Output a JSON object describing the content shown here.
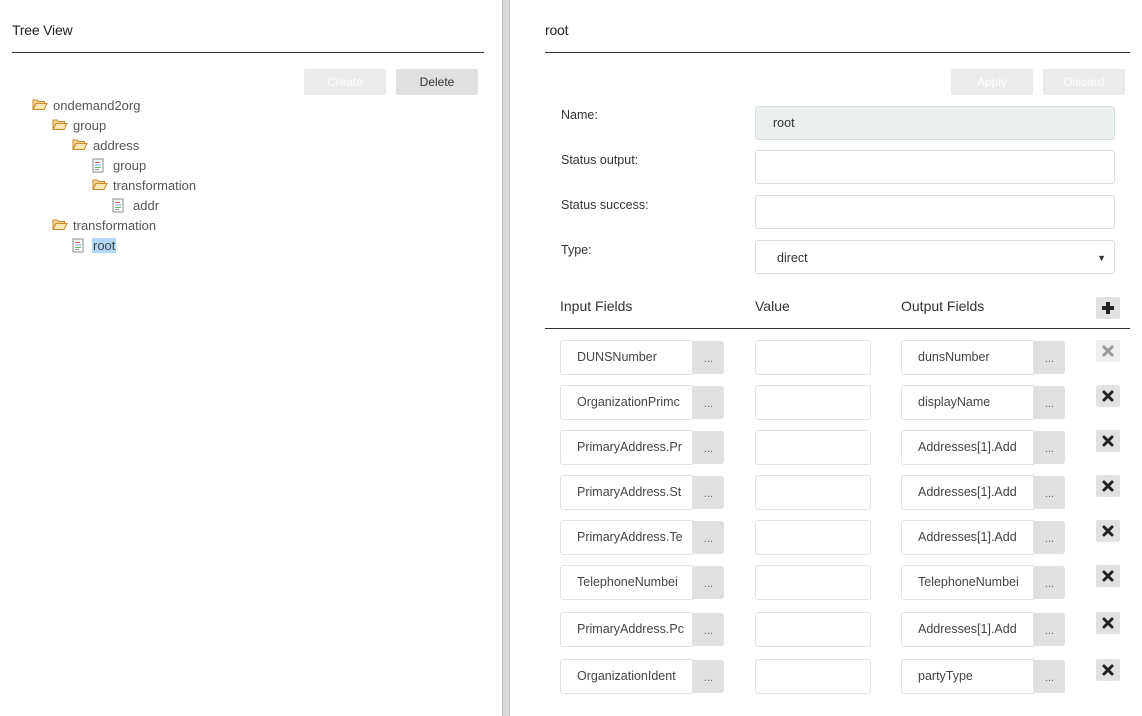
{
  "left_panel": {
    "title": "Tree View",
    "buttons": {
      "create": "Create",
      "delete": "Delete"
    },
    "tree": [
      {
        "label": "ondemand2org",
        "type": "folder",
        "depth": 0
      },
      {
        "label": "group",
        "type": "folder",
        "depth": 1
      },
      {
        "label": "address",
        "type": "folder",
        "depth": 2
      },
      {
        "label": "group",
        "type": "document",
        "depth": 3
      },
      {
        "label": "transformation",
        "type": "folder",
        "depth": 3
      },
      {
        "label": "addr",
        "type": "document",
        "depth": 4
      },
      {
        "label": "transformation",
        "type": "folder",
        "depth": 1
      },
      {
        "label": "root",
        "type": "document",
        "depth": 2,
        "selected": true
      }
    ]
  },
  "right_panel": {
    "title": "root",
    "buttons": {
      "apply": "Apply",
      "discard": "Discard"
    },
    "form": {
      "name_label": "Name:",
      "name_value": "root",
      "status_output_label": "Status output:",
      "status_output_value": "",
      "status_success_label": "Status success:",
      "status_success_value": "",
      "type_label": "Type:",
      "type_value": "direct"
    },
    "table": {
      "headers": {
        "input": "Input Fields",
        "value": "Value",
        "output": "Output Fields"
      },
      "ellipsis": "...",
      "rows": [
        {
          "input": "DUNSNumber",
          "value": "",
          "output": "dunsNumber",
          "delete_disabled": true
        },
        {
          "input": "OrganizationPrimc",
          "value": "",
          "output": "displayName",
          "delete_disabled": false
        },
        {
          "input": "PrimaryAddress.Pr",
          "value": "",
          "output": "Addresses[1].Add",
          "delete_disabled": false
        },
        {
          "input": "PrimaryAddress.St",
          "value": "",
          "output": "Addresses[1].Add",
          "delete_disabled": false
        },
        {
          "input": "PrimaryAddress.Te",
          "value": "",
          "output": "Addresses[1].Add",
          "delete_disabled": false
        },
        {
          "input": "TelephoneNumbei",
          "value": "",
          "output": "TelephoneNumbei",
          "delete_disabled": false
        },
        {
          "input": "PrimaryAddress.Pc",
          "value": "",
          "output": "Addresses[1].Add",
          "delete_disabled": false
        },
        {
          "input": "OrganizationIdent",
          "value": "",
          "output": "partyType",
          "delete_disabled": false
        }
      ]
    }
  },
  "colors": {
    "selection": "#b3d8f7",
    "folder": "#e8a33a",
    "button_bg": "#e0e0e0",
    "disabled_button_bg": "#ebebeb"
  }
}
